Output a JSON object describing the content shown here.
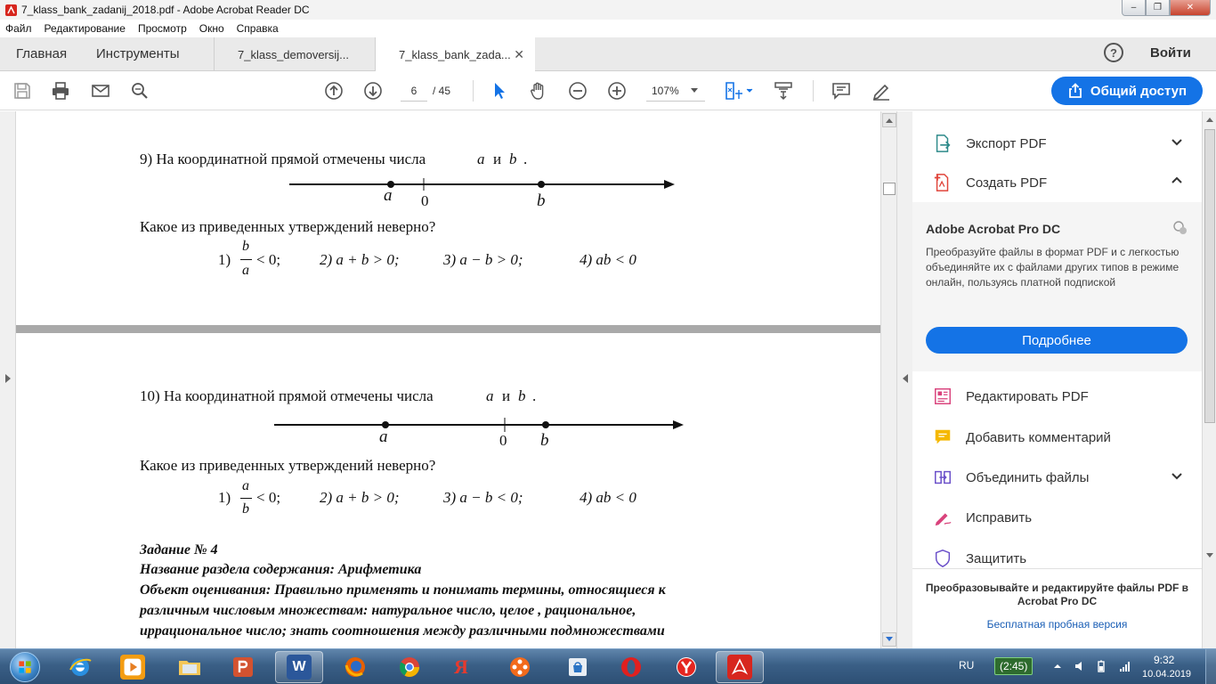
{
  "window": {
    "title": "7_klass_bank_zadanij_2018.pdf - Adobe Acrobat Reader DC",
    "minimize": "–",
    "maximize": "❐",
    "close": "✕"
  },
  "menu": [
    "Файл",
    "Редактирование",
    "Просмотр",
    "Окно",
    "Справка"
  ],
  "tabs": {
    "home": "Главная",
    "tools": "Инструменты",
    "docs": [
      {
        "label": "7_klass_demoversij...",
        "active": false
      },
      {
        "label": "7_klass_bank_zada...",
        "active": true
      }
    ],
    "close_glyph": "✕",
    "help": "?",
    "signin": "Войти"
  },
  "toolbar": {
    "page_current": "6",
    "page_total": "/ 45",
    "zoom": "107%",
    "share_label": "Общий доступ"
  },
  "document": {
    "q9": {
      "text": "9) На координатной прямой отмечены числа",
      "var_a": "a",
      "and": "и",
      "var_b": "b",
      "period": ".",
      "label_a": "a",
      "label_zero": "0",
      "label_b": "b",
      "question": "Какое из приведенных утверждений неверно?",
      "opt1_num": "1)",
      "opt1_numer": "b",
      "opt1_denom": "a",
      "opt1_rest": "< 0;",
      "opt2": "2)  a + b > 0;",
      "opt3": "3)  a − b > 0;",
      "opt4": "4)  ab < 0"
    },
    "q10": {
      "text": "10) На координатной прямой отмечены числа",
      "var_a": "a",
      "and": "и",
      "var_b": "b",
      "period": ".",
      "label_a": "a",
      "label_zero": "0",
      "label_b": "b",
      "question": "Какое из приведенных утверждений неверно?",
      "opt1_num": "1)",
      "opt1_numer": "a",
      "opt1_denom": "b",
      "opt1_rest": "< 0;",
      "opt2": "2)  a + b > 0;",
      "opt3": "3)  a − b < 0;",
      "opt4": "4)  ab < 0"
    },
    "task": {
      "line1": "Задание № 4",
      "line2": "Название раздела содержания: Арифметика",
      "line3": "Объект оценивания: Правильно применять и понимать термины, относящиеся к",
      "line4": "различным числовым множествам: натуральное число, целое , рациональное,",
      "line5": "иррациональное число; знать соотношения между различными подмножествами"
    }
  },
  "right_pane": {
    "export_pdf": "Экспорт PDF",
    "create_pdf": "Создать PDF",
    "promo_title": "Adobe Acrobat Pro DC",
    "promo_text": "Преобразуйте файлы в формат PDF и с легкостью объединяйте их с файлами других типов в режиме онлайн, пользуясь платной подпиской",
    "promo_button": "Подробнее",
    "edit_pdf": "Редактировать PDF",
    "add_comment": "Добавить комментарий",
    "combine_files": "Объединить файлы",
    "fill_sign": "Исправить",
    "protect": "Защитить",
    "footer_text": "Преобразовывайте и редактируйте файлы PDF в Acrobat Pro DC",
    "footer_link": "Бесплатная пробная версия"
  },
  "taskbar": {
    "lang": "RU",
    "battery": "(2:45)",
    "time": "9:32",
    "date": "10.04.2019",
    "yandex_letter": "Я",
    "word_letter": "W"
  },
  "colors": {
    "accent": "#1473e6",
    "title_bar": "#f3f3f3",
    "tab_bar": "#eaeaea",
    "doc_background": "#e4e4e4",
    "taskbar": "#3a5f86"
  }
}
